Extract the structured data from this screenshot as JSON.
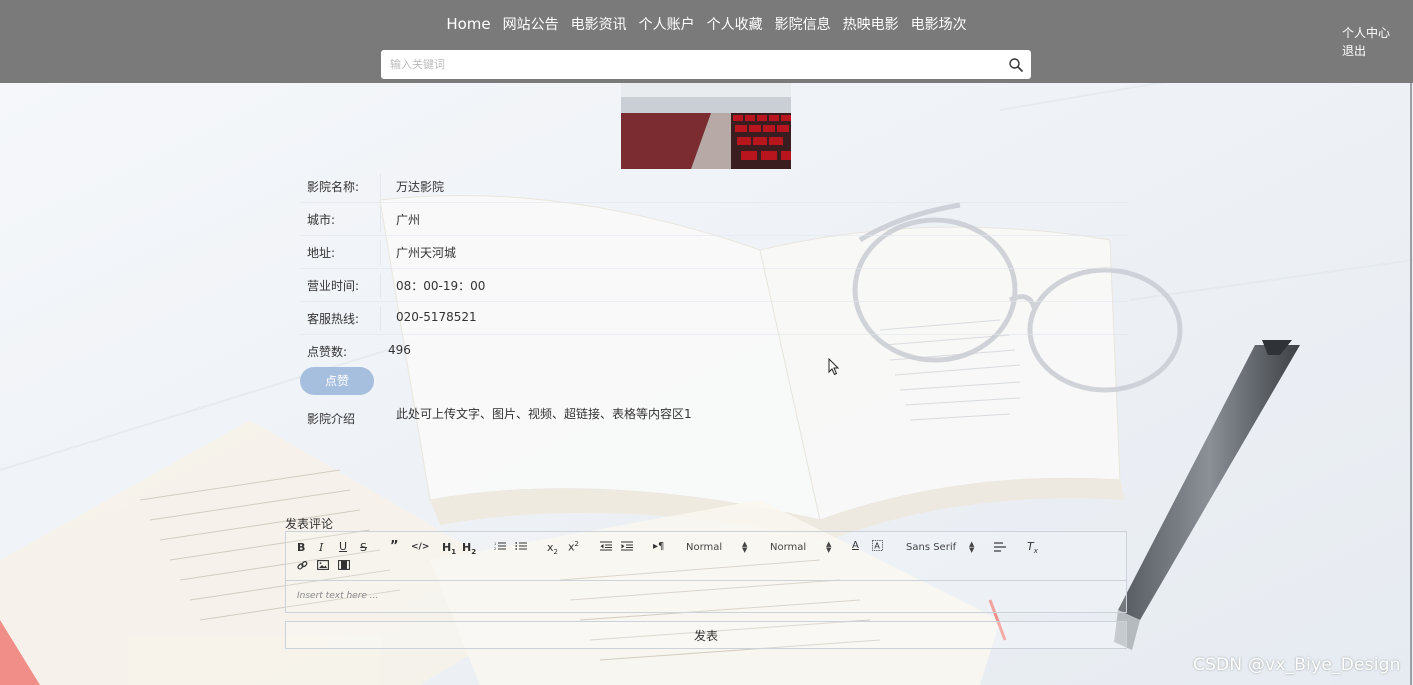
{
  "nav": {
    "items": [
      "Home",
      "网站公告",
      "电影资讯",
      "个人账户",
      "个人收藏",
      "影院信息",
      "热映电影",
      "电影场次"
    ]
  },
  "search": {
    "placeholder": "输入关键词"
  },
  "user_menu": {
    "center": "个人中心",
    "logout": "退出"
  },
  "cinema": {
    "fields": [
      {
        "label": "影院名称:",
        "value": "万达影院"
      },
      {
        "label": "城市:",
        "value": "广州"
      },
      {
        "label": "地址:",
        "value": "广州天河城"
      },
      {
        "label": "营业时间:",
        "value": "08：00-19：00"
      },
      {
        "label": "客服热线:",
        "value": "020-5178521"
      }
    ],
    "likes_label": "点赞数:",
    "likes_value": "496",
    "like_button": "点赞",
    "intro_label": "影院介绍",
    "intro_text": "此处可上传文字、图片、视频、超链接、表格等内容区1"
  },
  "comment": {
    "title": "发表评论",
    "toolbar": {
      "header_select": "Normal",
      "size_select": "Normal",
      "font_select": "Sans Serif"
    },
    "placeholder": "Insert text here ...",
    "submit": "发表"
  },
  "watermark": "CSDN @vx_Biye_Design",
  "colors": {
    "header_bg": "#7a7a7a",
    "like_button_bg": "#a7bfde"
  }
}
